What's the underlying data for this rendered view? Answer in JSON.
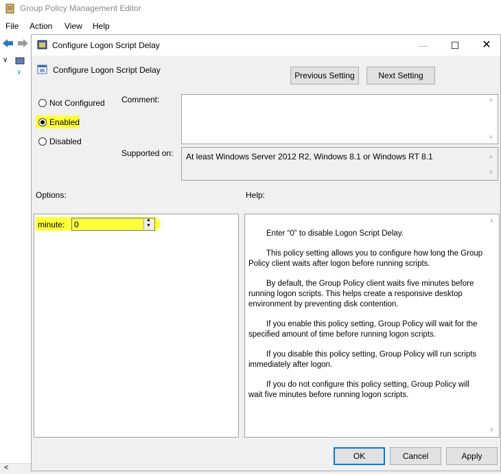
{
  "app": {
    "title": "Group Policy Management Editor",
    "menu": [
      "File",
      "Action",
      "View",
      "Help"
    ]
  },
  "dialog": {
    "window_title": "Configure Logon Script Delay",
    "setting_name": "Configure Logon Script Delay",
    "previous_label": "Previous Setting",
    "next_label": "Next Setting",
    "radios": {
      "not_configured": "Not Configured",
      "enabled": "Enabled",
      "disabled": "Disabled",
      "selected": "enabled"
    },
    "comment_label": "Comment:",
    "comment_value": "",
    "supported_label": "Supported on:",
    "supported_value": "At least Windows Server 2012 R2, Windows 8.1 or Windows RT 8.1",
    "options_label": "Options:",
    "help_label": "Help:",
    "minute_label": "minute:",
    "minute_value": "0",
    "help_paragraphs": [
      "Enter “0” to disable Logon Script Delay.",
      "This policy setting allows you to configure how long the Group Policy client waits after logon before running scripts.",
      "By default, the Group Policy client waits five minutes before running logon scripts. This helps create a responsive desktop environment by preventing disk contention.",
      "If you enable this policy setting, Group Policy will wait for the specified amount of time before running logon scripts.",
      "If you disable this policy setting, Group Policy will run scripts immediately after logon.",
      "If you do not configure this policy setting, Group Policy will wait five minutes before running logon scripts."
    ],
    "ok_label": "OK",
    "cancel_label": "Cancel",
    "apply_label": "Apply"
  },
  "colors": {
    "highlight": "#ffff3c",
    "accent": "#0078d7"
  }
}
